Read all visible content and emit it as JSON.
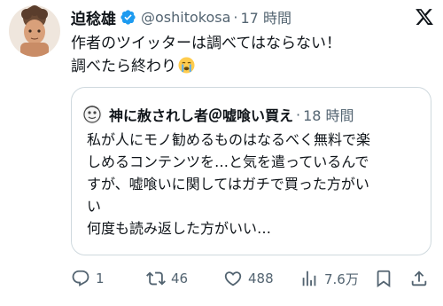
{
  "tweet": {
    "author_name": "迫稔雄",
    "handle": "@oshitokosa",
    "separator": "·",
    "time": "17 時間",
    "body_lines": [
      "作者のツイッターは調べてはならない！",
      "調べたら終わり"
    ],
    "emoji_icon": "crying-face-emoji"
  },
  "quote": {
    "author_name": "神に赦されし者＠嘘喰い買え",
    "separator": "·",
    "time": "18 時間",
    "body_lines": [
      "私が人にモノ勧めるものはなるべく無料で楽",
      "しめるコンテンツを…と気を遣っているんで",
      "すが、嘘喰いに関してはガチで買った方がい",
      "い",
      "何度も読み返した方がいい…"
    ]
  },
  "actions": {
    "reply_count": "1",
    "retweet_count": "46",
    "like_count": "488",
    "view_count": "7.6万"
  },
  "colors": {
    "text": "#0f1419",
    "secondary": "#536471",
    "verified": "#1d9bf0",
    "border": "#cfd9de"
  }
}
